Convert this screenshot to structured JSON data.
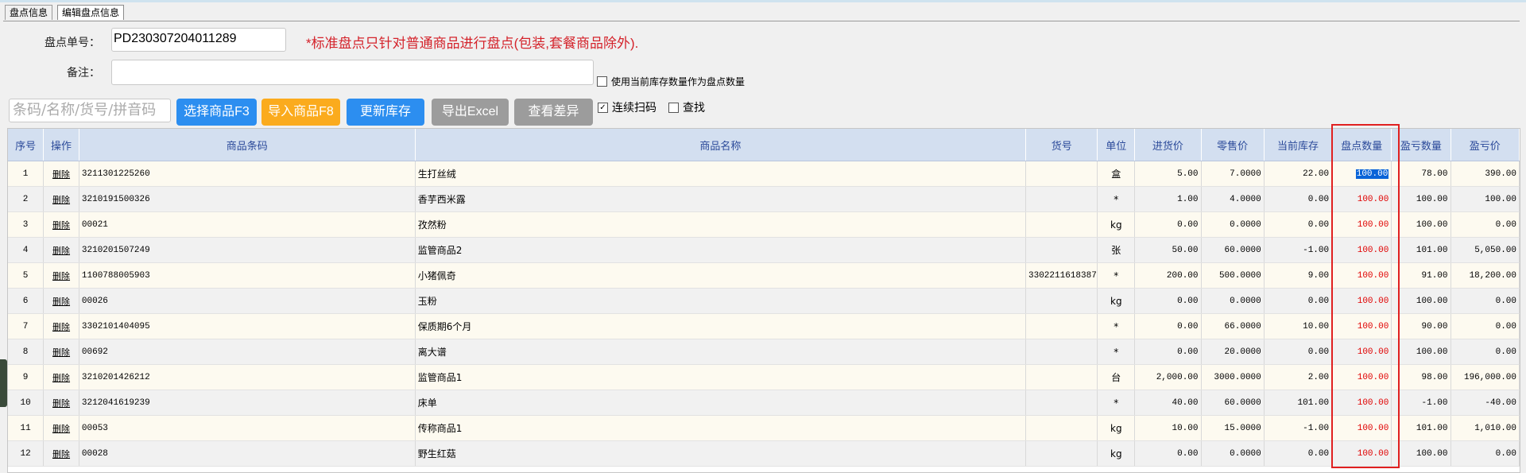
{
  "tabs": [
    {
      "label": "盘点信息",
      "active": false
    },
    {
      "label": "编辑盘点信息",
      "active": true
    }
  ],
  "form": {
    "order_no_label": "盘点单号：",
    "order_no_value": "PD230307204011289",
    "remark_label": "备注：",
    "remark_value": "",
    "notice": "*标准盘点只针对普通商品进行盘点(包装,套餐商品除外).",
    "use_stock_label": "使用当前库存数量作为盘点数量",
    "use_stock_checked": false
  },
  "toolbar": {
    "search_placeholder": "条码/名称/货号/拼音码",
    "select_button": "选择商品F3",
    "import_button": "导入商品F8",
    "update_button": "更新库存",
    "export_button": "导出Excel",
    "diff_button": "查看差异",
    "continuous_scan_label": "连续扫码",
    "continuous_scan_checked": true,
    "continuous_scan_mark": "✓",
    "find_label": "查找",
    "find_checked": false
  },
  "colors": {
    "accent_blue": "#2c8ef0",
    "accent_orange": "#fbab1d",
    "disabled_gray": "#9c9c9c",
    "notice_red": "#d4232b",
    "header_blue": "#d3dff0",
    "highlight_red": "#e02020"
  },
  "table": {
    "columns": [
      "序号",
      "操作",
      "商品条码",
      "商品名称",
      "货号",
      "单位",
      "进货价",
      "零售价",
      "当前库存",
      "盘点数量",
      "盈亏数量",
      "盈亏价"
    ],
    "rows": [
      [
        "1",
        "删除",
        "3211301225260",
        "生打丝绒",
        "",
        "盒",
        "5.00",
        "7.0000",
        "22.00",
        "100.00",
        "78.00",
        "390.00"
      ],
      [
        "2",
        "删除",
        "3210191500326",
        "香芋西米露",
        "",
        "*",
        "1.00",
        "4.0000",
        "0.00",
        "100.00",
        "100.00",
        "100.00"
      ],
      [
        "3",
        "删除",
        "00021",
        "孜然粉",
        "",
        "kg",
        "0.00",
        "0.0000",
        "0.00",
        "100.00",
        "100.00",
        "0.00"
      ],
      [
        "4",
        "删除",
        "3210201507249",
        "监管商品2",
        "",
        "张",
        "50.00",
        "60.0000",
        "-1.00",
        "100.00",
        "101.00",
        "5,050.00"
      ],
      [
        "5",
        "删除",
        "1100788005903",
        "小猪佩奇",
        "3302211618387",
        "*",
        "200.00",
        "500.0000",
        "9.00",
        "100.00",
        "91.00",
        "18,200.00"
      ],
      [
        "6",
        "删除",
        "00026",
        "玉粉",
        "",
        "kg",
        "0.00",
        "0.0000",
        "0.00",
        "100.00",
        "100.00",
        "0.00"
      ],
      [
        "7",
        "删除",
        "3302101404095",
        "保质期6个月",
        "",
        "*",
        "0.00",
        "66.0000",
        "10.00",
        "100.00",
        "90.00",
        "0.00"
      ],
      [
        "8",
        "删除",
        "00692",
        "离大谱",
        "",
        "*",
        "0.00",
        "20.0000",
        "0.00",
        "100.00",
        "100.00",
        "0.00"
      ],
      [
        "9",
        "删除",
        "3210201426212",
        "监管商品1",
        "",
        "台",
        "2,000.00",
        "3000.0000",
        "2.00",
        "100.00",
        "98.00",
        "196,000.00"
      ],
      [
        "10",
        "删除",
        "3212041619239",
        "床单",
        "",
        "*",
        "40.00",
        "60.0000",
        "101.00",
        "100.00",
        "-1.00",
        "-40.00"
      ],
      [
        "11",
        "删除",
        "00053",
        "传称商品1",
        "",
        "kg",
        "10.00",
        "15.0000",
        "-1.00",
        "100.00",
        "101.00",
        "1,010.00"
      ],
      [
        "12",
        "删除",
        "00028",
        "野生红菇",
        "",
        "kg",
        "0.00",
        "0.0000",
        "0.00",
        "100.00",
        "100.00",
        "0.00"
      ]
    ]
  }
}
